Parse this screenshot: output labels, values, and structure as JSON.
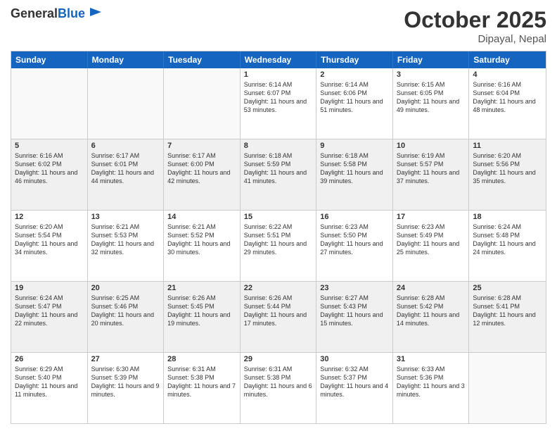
{
  "header": {
    "logo_general": "General",
    "logo_blue": "Blue",
    "month_title": "October 2025",
    "location": "Dipayal, Nepal"
  },
  "weekdays": [
    "Sunday",
    "Monday",
    "Tuesday",
    "Wednesday",
    "Thursday",
    "Friday",
    "Saturday"
  ],
  "weeks": [
    [
      {
        "day": "",
        "empty": true
      },
      {
        "day": "",
        "empty": true
      },
      {
        "day": "",
        "empty": true
      },
      {
        "day": "1",
        "sunrise": "6:14 AM",
        "sunset": "6:07 PM",
        "daylight": "11 hours and 53 minutes."
      },
      {
        "day": "2",
        "sunrise": "6:14 AM",
        "sunset": "6:06 PM",
        "daylight": "11 hours and 51 minutes."
      },
      {
        "day": "3",
        "sunrise": "6:15 AM",
        "sunset": "6:05 PM",
        "daylight": "11 hours and 49 minutes."
      },
      {
        "day": "4",
        "sunrise": "6:16 AM",
        "sunset": "6:04 PM",
        "daylight": "11 hours and 48 minutes."
      }
    ],
    [
      {
        "day": "5",
        "sunrise": "6:16 AM",
        "sunset": "6:02 PM",
        "daylight": "11 hours and 46 minutes."
      },
      {
        "day": "6",
        "sunrise": "6:17 AM",
        "sunset": "6:01 PM",
        "daylight": "11 hours and 44 minutes."
      },
      {
        "day": "7",
        "sunrise": "6:17 AM",
        "sunset": "6:00 PM",
        "daylight": "11 hours and 42 minutes."
      },
      {
        "day": "8",
        "sunrise": "6:18 AM",
        "sunset": "5:59 PM",
        "daylight": "11 hours and 41 minutes."
      },
      {
        "day": "9",
        "sunrise": "6:18 AM",
        "sunset": "5:58 PM",
        "daylight": "11 hours and 39 minutes."
      },
      {
        "day": "10",
        "sunrise": "6:19 AM",
        "sunset": "5:57 PM",
        "daylight": "11 hours and 37 minutes."
      },
      {
        "day": "11",
        "sunrise": "6:20 AM",
        "sunset": "5:56 PM",
        "daylight": "11 hours and 35 minutes."
      }
    ],
    [
      {
        "day": "12",
        "sunrise": "6:20 AM",
        "sunset": "5:54 PM",
        "daylight": "11 hours and 34 minutes."
      },
      {
        "day": "13",
        "sunrise": "6:21 AM",
        "sunset": "5:53 PM",
        "daylight": "11 hours and 32 minutes."
      },
      {
        "day": "14",
        "sunrise": "6:21 AM",
        "sunset": "5:52 PM",
        "daylight": "11 hours and 30 minutes."
      },
      {
        "day": "15",
        "sunrise": "6:22 AM",
        "sunset": "5:51 PM",
        "daylight": "11 hours and 29 minutes."
      },
      {
        "day": "16",
        "sunrise": "6:23 AM",
        "sunset": "5:50 PM",
        "daylight": "11 hours and 27 minutes."
      },
      {
        "day": "17",
        "sunrise": "6:23 AM",
        "sunset": "5:49 PM",
        "daylight": "11 hours and 25 minutes."
      },
      {
        "day": "18",
        "sunrise": "6:24 AM",
        "sunset": "5:48 PM",
        "daylight": "11 hours and 24 minutes."
      }
    ],
    [
      {
        "day": "19",
        "sunrise": "6:24 AM",
        "sunset": "5:47 PM",
        "daylight": "11 hours and 22 minutes."
      },
      {
        "day": "20",
        "sunrise": "6:25 AM",
        "sunset": "5:46 PM",
        "daylight": "11 hours and 20 minutes."
      },
      {
        "day": "21",
        "sunrise": "6:26 AM",
        "sunset": "5:45 PM",
        "daylight": "11 hours and 19 minutes."
      },
      {
        "day": "22",
        "sunrise": "6:26 AM",
        "sunset": "5:44 PM",
        "daylight": "11 hours and 17 minutes."
      },
      {
        "day": "23",
        "sunrise": "6:27 AM",
        "sunset": "5:43 PM",
        "daylight": "11 hours and 15 minutes."
      },
      {
        "day": "24",
        "sunrise": "6:28 AM",
        "sunset": "5:42 PM",
        "daylight": "11 hours and 14 minutes."
      },
      {
        "day": "25",
        "sunrise": "6:28 AM",
        "sunset": "5:41 PM",
        "daylight": "11 hours and 12 minutes."
      }
    ],
    [
      {
        "day": "26",
        "sunrise": "6:29 AM",
        "sunset": "5:40 PM",
        "daylight": "11 hours and 11 minutes."
      },
      {
        "day": "27",
        "sunrise": "6:30 AM",
        "sunset": "5:39 PM",
        "daylight": "11 hours and 9 minutes."
      },
      {
        "day": "28",
        "sunrise": "6:31 AM",
        "sunset": "5:38 PM",
        "daylight": "11 hours and 7 minutes."
      },
      {
        "day": "29",
        "sunrise": "6:31 AM",
        "sunset": "5:38 PM",
        "daylight": "11 hours and 6 minutes."
      },
      {
        "day": "30",
        "sunrise": "6:32 AM",
        "sunset": "5:37 PM",
        "daylight": "11 hours and 4 minutes."
      },
      {
        "day": "31",
        "sunrise": "6:33 AM",
        "sunset": "5:36 PM",
        "daylight": "11 hours and 3 minutes."
      },
      {
        "day": "",
        "empty": true
      }
    ]
  ],
  "labels": {
    "sunrise": "Sunrise:",
    "sunset": "Sunset:",
    "daylight": "Daylight:"
  }
}
